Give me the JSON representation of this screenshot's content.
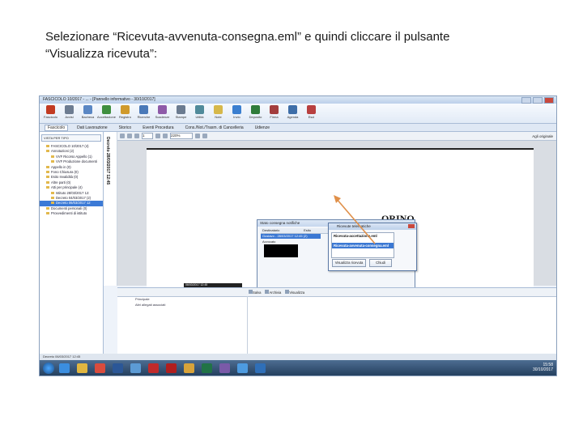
{
  "caption": {
    "line1": "Selezionare “Ricevuta-avvenuta-consegna.eml” e quindi cliccare il pulsante",
    "line2": "“Visualizza ricevuta”:"
  },
  "screenshot": {
    "window_title": "FASCICOLO 10/2017 - ... - [Pannello informativo - 30/10/2017]",
    "ribbon_buttons": [
      {
        "label": "Fascicolo",
        "icon": "red-folder-icon",
        "color": "#c23b22"
      },
      {
        "label": "Avvisi",
        "icon": "clock-icon",
        "color": "#6d7c91"
      },
      {
        "label": "Bacheca",
        "icon": "page-icon",
        "color": "#5a87c4"
      },
      {
        "label": "Accettazione",
        "icon": "check-icon",
        "color": "#3f8f3f"
      },
      {
        "label": "Registro",
        "icon": "book-icon",
        "color": "#d09a2c"
      },
      {
        "label": "Ricerche",
        "icon": "search-icon",
        "color": "#4a79b8"
      },
      {
        "label": "Scadenze",
        "icon": "calendar-icon",
        "color": "#8e5aa8"
      },
      {
        "label": "Stampe",
        "icon": "print-icon",
        "color": "#6b7b90"
      },
      {
        "label": "Utilità",
        "icon": "tools-icon",
        "color": "#508a9a"
      },
      {
        "label": "Note",
        "icon": "note-icon",
        "color": "#d6b84a"
      },
      {
        "label": "Invio",
        "icon": "send-icon",
        "color": "#3b7fd0"
      },
      {
        "label": "Deposito",
        "icon": "upload-icon",
        "color": "#2f7c3a"
      },
      {
        "label": "Firma",
        "icon": "pen-icon",
        "color": "#a33d3d"
      },
      {
        "label": "Agenda",
        "icon": "agenda-icon",
        "color": "#3e6ea8"
      },
      {
        "label": "Esci",
        "icon": "exit-icon",
        "color": "#b84040"
      }
    ],
    "tabs": [
      "Fascicolo",
      "Dati Lavorazione",
      "Storico",
      "Eventi Procedura",
      "Cons./Not./Trasm. di Cancelleria",
      "Udienze"
    ],
    "tree": {
      "selector": "VISTA PER TIPO",
      "items": [
        {
          "label": "FASCICOLO 10/2017 (4)",
          "level": 1
        },
        {
          "label": "Annotazioni (2)",
          "level": 1
        },
        {
          "label": "VVF Ricorso Appello (1)",
          "level": 2
        },
        {
          "label": "VVF Produzione documenti",
          "level": 2
        },
        {
          "label": "Appello in (0)",
          "level": 1
        },
        {
          "label": "Fono Chiusura (0)",
          "level": 1
        },
        {
          "label": "Esito Invalidità (0)",
          "level": 1
        },
        {
          "label": "Altre parti (0)",
          "level": 1
        },
        {
          "label": "Atti per principale (4)",
          "level": 1
        },
        {
          "label": "Istituto 28/03/2017 12:",
          "level": 2
        },
        {
          "label": "Decreto 04/03/2017 (2)",
          "level": 2
        },
        {
          "label": "Decreto 06/03/2017 12",
          "level": 2,
          "selected": true
        },
        {
          "label": "Documenti personali (0)",
          "level": 1
        },
        {
          "label": "Provvedimenti di istituto",
          "level": 1
        }
      ]
    },
    "document_strip_label": "Decreto 28/03/2017 12:45",
    "viewer_zoom": "220%",
    "viewer_page": "1",
    "viewer_tool_label": "Agli originale",
    "document_heading": "ORINO",
    "dialog_stato": {
      "title": "Stato consegna notifiche",
      "columns": [
        "Destinatario",
        "Esito",
        "Data Perfezionamento",
        "Ricevute"
      ],
      "rows": [
        "Gustavo - 28/03/2017 12:45 (2)",
        "Avvocato"
      ]
    },
    "dialog_ricevute": {
      "title": "Ricevute telematiche",
      "items": [
        "Ricevuta-accettazione.eml",
        "Ricevuta-avvenuta-consegna.eml"
      ],
      "selected_index": 1,
      "button_view": "Visualizza ricevuta",
      "button_close": "Chiudi"
    },
    "lower_strip": "06/03/2017 12:45",
    "lower_tools": [
      "Salva",
      "Archivia",
      "Visualizza"
    ],
    "lower_options": [
      "Principale",
      "Altri allegati associati"
    ],
    "status_text": "Decreto 06/03/2017 12:45",
    "taskbar": {
      "apps": [
        {
          "name": "ie-icon",
          "color": "#3b8ee0"
        },
        {
          "name": "explorer-icon",
          "color": "#e0b640"
        },
        {
          "name": "chrome-icon",
          "color": "#d94c3d"
        },
        {
          "name": "word-icon",
          "color": "#2b5797"
        },
        {
          "name": "app-icon",
          "color": "#5c9bd5"
        },
        {
          "name": "pdf-icon",
          "color": "#c12b2b"
        },
        {
          "name": "acrobat-icon",
          "color": "#b01e1e"
        },
        {
          "name": "folder-icon",
          "color": "#d8a33a"
        },
        {
          "name": "excel-icon",
          "color": "#217346"
        },
        {
          "name": "ps-icon",
          "color": "#7a5aa8"
        },
        {
          "name": "cloud-icon",
          "color": "#4d9be0"
        },
        {
          "name": "outlook-icon",
          "color": "#2f6fb8"
        }
      ],
      "time": "15:58",
      "date": "30/10/2017"
    }
  }
}
